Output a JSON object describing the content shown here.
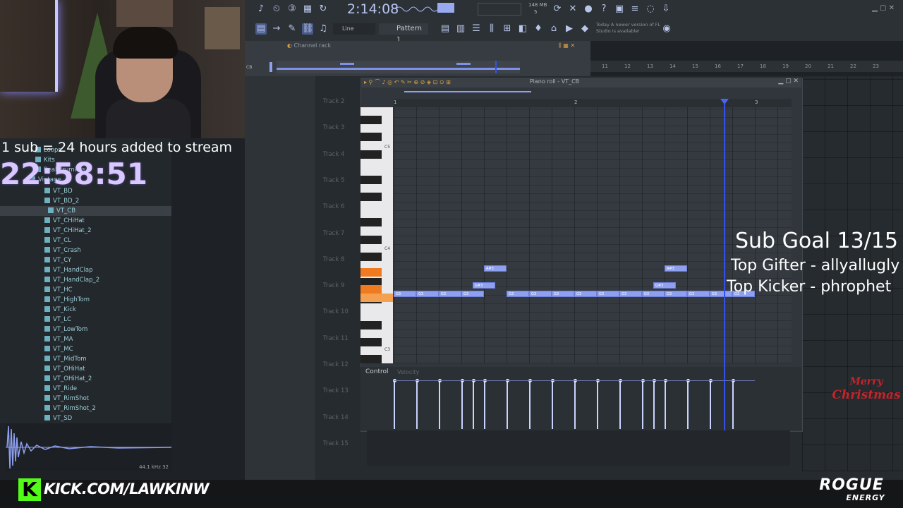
{
  "overlay": {
    "sub_notice": "1 sub = 24 hours added to stream",
    "timer": "22:58:51",
    "sub_goal": "Sub Goal 13/15",
    "top_gifter": "Top Gifter - allyallugly",
    "top_kicker": "Top Kicker - phrophet",
    "kick_url": "KICK.COM/LAWKINW",
    "christmas_l1": "Merry",
    "christmas_l2": "Christmas",
    "sponsor_name": "ROGUE",
    "sponsor_sub": "ENERGY"
  },
  "toolbar": {
    "song_time": "2:14:08",
    "memory_value": "148 MB",
    "memory_cpu": "5",
    "snap_label": "Line",
    "pattern_label": "Pattern 1",
    "hint_label": "Today",
    "hint_text": "A newer version of FL Studio is available!"
  },
  "channel_rack": {
    "title": "Channel rack",
    "cb_label": "CB"
  },
  "playlist": {
    "ruler": [
      "11",
      "12",
      "13",
      "14",
      "15",
      "16",
      "17",
      "18",
      "19",
      "20",
      "21",
      "22",
      "23"
    ],
    "tracks": [
      "Track 2",
      "Track 3",
      "Track 4",
      "Track 5",
      "Track 6",
      "Track 7",
      "Track 8",
      "Track 9",
      "Track 10",
      "Track 11",
      "Track 12",
      "Track 13",
      "Track 14",
      "Track 15"
    ]
  },
  "browser": {
    "folders": [
      "Loops",
      "Kits",
      "Real drumkits",
      "Vintage"
    ],
    "items": [
      "VT_BD",
      "VT_BD_2",
      "VT_CB",
      "VT_CHiHat",
      "VT_CHiHat_2",
      "VT_CL",
      "VT_Crash",
      "VT_CY",
      "VT_HandClap",
      "VT_HandClap_2",
      "VT_HC",
      "VT_HighTom",
      "VT_Kick",
      "VT_LC",
      "VT_LowTom",
      "VT_MA",
      "VT_MC",
      "VT_MidTom",
      "VT_OHiHat",
      "VT_OHiHat_2",
      "VT_Ride",
      "VT_RimShot",
      "VT_RimShot_2",
      "VT_SD"
    ],
    "selected": "VT_CB",
    "sample_info": "44.1 kHz 32"
  },
  "piano_roll": {
    "title": "Piano roll - VT_CB",
    "bar_markers": [
      "1",
      "2",
      "3"
    ],
    "key_labels": [
      "C5",
      "C4",
      "C3"
    ],
    "control_label": "Control",
    "control_param": "Velocity",
    "notes": [
      {
        "label": "G3"
      },
      {
        "label": "G3"
      },
      {
        "label": "G3"
      },
      {
        "label": "G3"
      },
      {
        "label": "G#3"
      },
      {
        "label": "A#3"
      },
      {
        "label": "G3"
      },
      {
        "label": "G3"
      },
      {
        "label": "G3"
      },
      {
        "label": "G3"
      },
      {
        "label": "G3"
      },
      {
        "label": "G3"
      },
      {
        "label": "G3"
      },
      {
        "label": "G3"
      },
      {
        "label": "G#3"
      },
      {
        "label": "A#3"
      },
      {
        "label": "G3"
      },
      {
        "label": "G3"
      },
      {
        "label": "G3"
      }
    ]
  },
  "colors": {
    "note_fill": "#8fa0f0",
    "playhead": "#3552e8",
    "timer_color": "#d8c8ff",
    "kick_green": "#53fc18"
  }
}
